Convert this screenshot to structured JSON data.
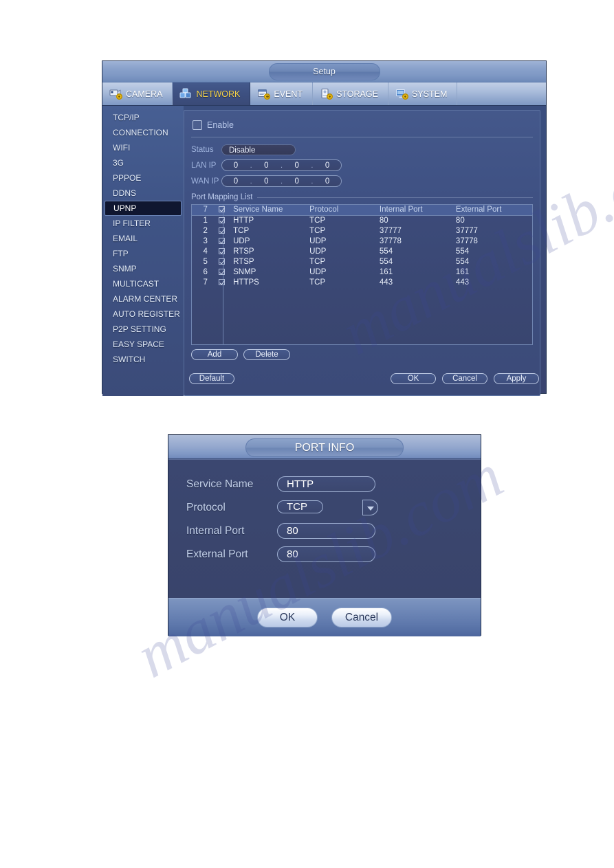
{
  "setup": {
    "title": "Setup",
    "tabs": [
      {
        "label": "CAMERA",
        "icon": "camera-icon",
        "active": false
      },
      {
        "label": "NETWORK",
        "icon": "network-icon",
        "active": true
      },
      {
        "label": "EVENT",
        "icon": "event-icon",
        "active": false
      },
      {
        "label": "STORAGE",
        "icon": "storage-icon",
        "active": false
      },
      {
        "label": "SYSTEM",
        "icon": "system-icon",
        "active": false
      }
    ],
    "sidebar": {
      "items": [
        {
          "label": "TCP/IP",
          "active": false
        },
        {
          "label": "CONNECTION",
          "active": false
        },
        {
          "label": "WIFI",
          "active": false
        },
        {
          "label": "3G",
          "active": false
        },
        {
          "label": "PPPOE",
          "active": false
        },
        {
          "label": "DDNS",
          "active": false
        },
        {
          "label": "UPNP",
          "active": true
        },
        {
          "label": "IP FILTER",
          "active": false
        },
        {
          "label": "EMAIL",
          "active": false
        },
        {
          "label": "FTP",
          "active": false
        },
        {
          "label": "SNMP",
          "active": false
        },
        {
          "label": "MULTICAST",
          "active": false
        },
        {
          "label": "ALARM CENTER",
          "active": false
        },
        {
          "label": "AUTO REGISTER",
          "active": false
        },
        {
          "label": "P2P SETTING",
          "active": false
        },
        {
          "label": "EASY SPACE",
          "active": false
        },
        {
          "label": "SWITCH",
          "active": false
        }
      ]
    },
    "form": {
      "enable_label": "Enable",
      "enable_checked": false,
      "status_label": "Status",
      "status_value": "Disable",
      "lan_ip_label": "LAN IP",
      "lan_ip": [
        "0",
        "0",
        "0",
        "0"
      ],
      "wan_ip_label": "WAN IP",
      "wan_ip": [
        "0",
        "0",
        "0",
        "0"
      ],
      "ip_separator": "."
    },
    "port_mapping": {
      "title": "Port Mapping List",
      "headers": {
        "count": "7",
        "service_name": "Service Name",
        "protocol": "Protocol",
        "internal_port": "Internal Port",
        "external_port": "External Port"
      },
      "rows": [
        {
          "n": "1",
          "checked": true,
          "service": "HTTP",
          "protocol": "TCP",
          "internal": "80",
          "external": "80"
        },
        {
          "n": "2",
          "checked": true,
          "service": "TCP",
          "protocol": "TCP",
          "internal": "37777",
          "external": "37777"
        },
        {
          "n": "3",
          "checked": true,
          "service": "UDP",
          "protocol": "UDP",
          "internal": "37778",
          "external": "37778"
        },
        {
          "n": "4",
          "checked": true,
          "service": "RTSP",
          "protocol": "UDP",
          "internal": "554",
          "external": "554"
        },
        {
          "n": "5",
          "checked": true,
          "service": "RTSP",
          "protocol": "TCP",
          "internal": "554",
          "external": "554"
        },
        {
          "n": "6",
          "checked": true,
          "service": "SNMP",
          "protocol": "UDP",
          "internal": "161",
          "external": "161"
        },
        {
          "n": "7",
          "checked": true,
          "service": "HTTPS",
          "protocol": "TCP",
          "internal": "443",
          "external": "443"
        }
      ]
    },
    "buttons": {
      "add": "Add",
      "delete": "Delete",
      "default": "Default",
      "ok": "OK",
      "cancel": "Cancel",
      "apply": "Apply"
    }
  },
  "dialog": {
    "title": "PORT INFO",
    "fields": {
      "service_name_label": "Service Name",
      "service_name_value": "HTTP",
      "protocol_label": "Protocol",
      "protocol_value": "TCP",
      "internal_port_label": "Internal Port",
      "internal_port_value": "80",
      "external_port_label": "External Port",
      "external_port_value": "80"
    },
    "buttons": {
      "ok": "OK",
      "cancel": "Cancel"
    }
  },
  "watermark": {
    "text1": "manualslib.com",
    "text2": "manualslib.com"
  },
  "colors": {
    "accent_active_tab_text": "#f6d44a",
    "window_bg": "#3a4a78",
    "table_header_bg": "#4a6098",
    "sidebar_active_bg": "#0f1630"
  }
}
